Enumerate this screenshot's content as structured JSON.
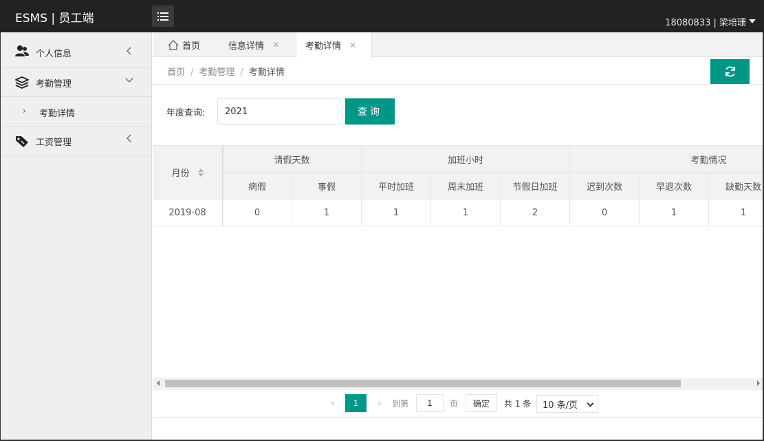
{
  "header": {
    "brand": "ESMS | 员工端",
    "user": "18080833 | 梁培珊"
  },
  "sidebar": {
    "items": [
      {
        "label": "个人信息",
        "icon": "user-group-icon"
      },
      {
        "label": "考勤管理",
        "icon": "layers-icon"
      },
      {
        "label": "考勤详情"
      },
      {
        "label": "工资管理",
        "icon": "tag-icon"
      }
    ]
  },
  "tabs": [
    {
      "label": "首页"
    },
    {
      "label": "信息详情"
    },
    {
      "label": "考勤详情"
    }
  ],
  "breadcrumb": {
    "items": [
      "首页",
      "考勤管理",
      "考勤详情"
    ]
  },
  "search": {
    "label": "年度查询:",
    "value": "2021",
    "button": "查询"
  },
  "table": {
    "month_header": "月份",
    "groups": [
      "请假天数",
      "加班小时",
      "考勤情况"
    ],
    "columns": [
      "病假",
      "事假",
      "平时加班",
      "周末加班",
      "节假日加班",
      "迟到次数",
      "早退次数",
      "缺勤天数"
    ],
    "rows": [
      {
        "month": "2019-08",
        "values": [
          "0",
          "1",
          "1",
          "1",
          "2",
          "0",
          "1",
          "1"
        ]
      }
    ]
  },
  "pagination": {
    "current": "1",
    "goto_label": "到第",
    "goto_value": "1",
    "page_label": "页",
    "confirm": "确定",
    "total": "共 1 条",
    "page_size": "10 条/页"
  },
  "colors": {
    "accent": "#009688",
    "topbar": "#222222",
    "sidebar": "#efefef"
  }
}
